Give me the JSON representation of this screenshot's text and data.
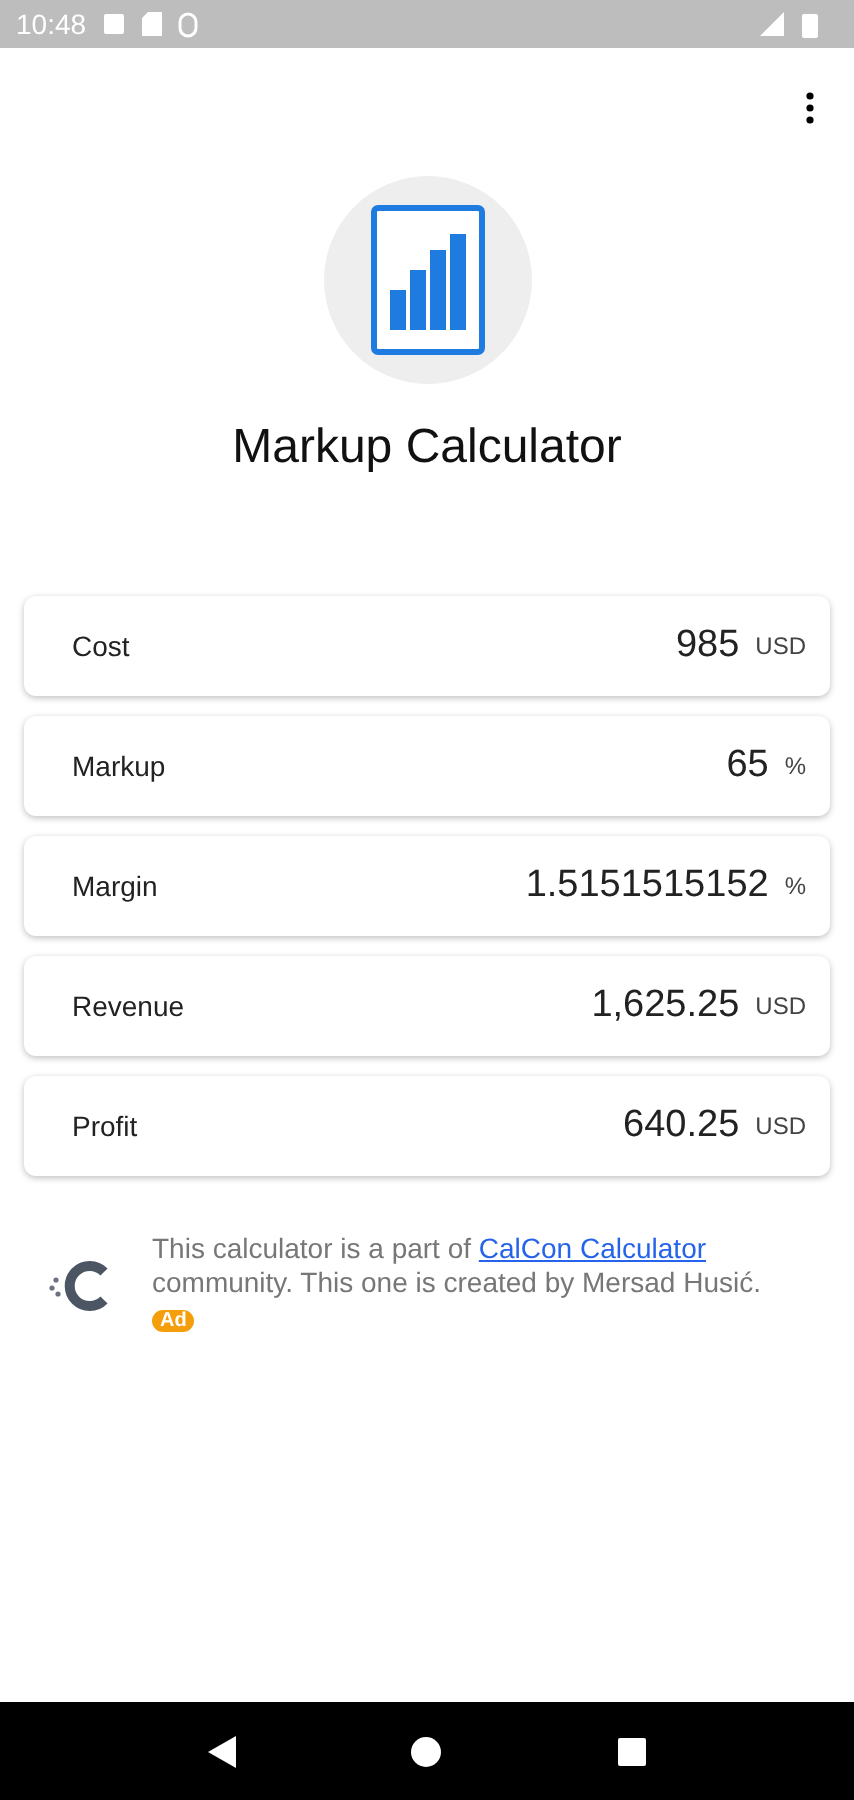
{
  "status_bar": {
    "time": "10:48"
  },
  "app": {
    "title": "Markup Calculator"
  },
  "fields": [
    {
      "label": "Cost",
      "value": "985",
      "unit": "USD"
    },
    {
      "label": "Markup",
      "value": "65",
      "unit": "%"
    },
    {
      "label": "Margin",
      "value": "1.5151515152",
      "unit": "%"
    },
    {
      "label": "Revenue",
      "value": "1,625.25",
      "unit": "USD"
    },
    {
      "label": "Profit",
      "value": "640.25",
      "unit": "USD"
    }
  ],
  "footer": {
    "text_before": "This calculator is a part of ",
    "link": "CalCon Calculator",
    "text_after": " community. This one is created by Mersad Husić. ",
    "badge": "Ad"
  }
}
